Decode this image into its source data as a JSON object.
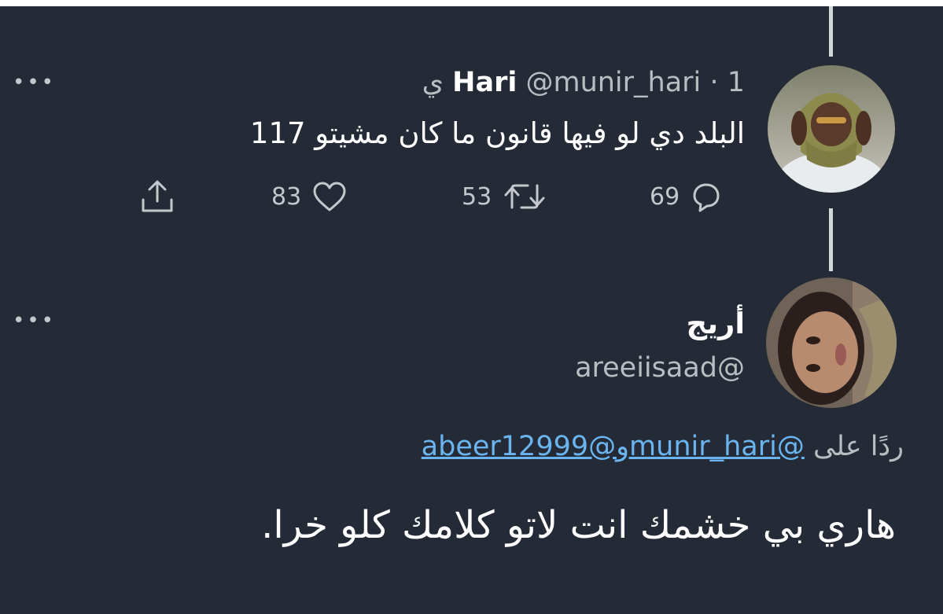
{
  "tweet1": {
    "author_name": "Hari",
    "author_handle": "@munir_hari",
    "separator": "·",
    "time": "1 ي",
    "text": "البلد دي لو فيها قانون ما كان مشيتو 117",
    "more_label": "•••",
    "actions": {
      "replies": "69",
      "retweets": "53",
      "likes": "83"
    }
  },
  "tweet2": {
    "author_name": "أريج",
    "author_handle": "@areeiisaad",
    "more_label": "•••",
    "reply_prefix": "ردًا على",
    "mention1": "@munir_hari",
    "conjunction": "و",
    "mention2": "@abeer12999",
    "text": "هاري بي خشمك انت لاتو كلامك كلو خرا."
  },
  "icons": {
    "reply": "reply-icon",
    "retweet": "retweet-icon",
    "like": "heart-icon",
    "share": "share-icon",
    "more": "more-icon"
  },
  "colors": {
    "background": "#242b36",
    "link": "#6ab4f0",
    "secondary_text": "#b8bdc2",
    "thread_line": "#d3d6da"
  }
}
